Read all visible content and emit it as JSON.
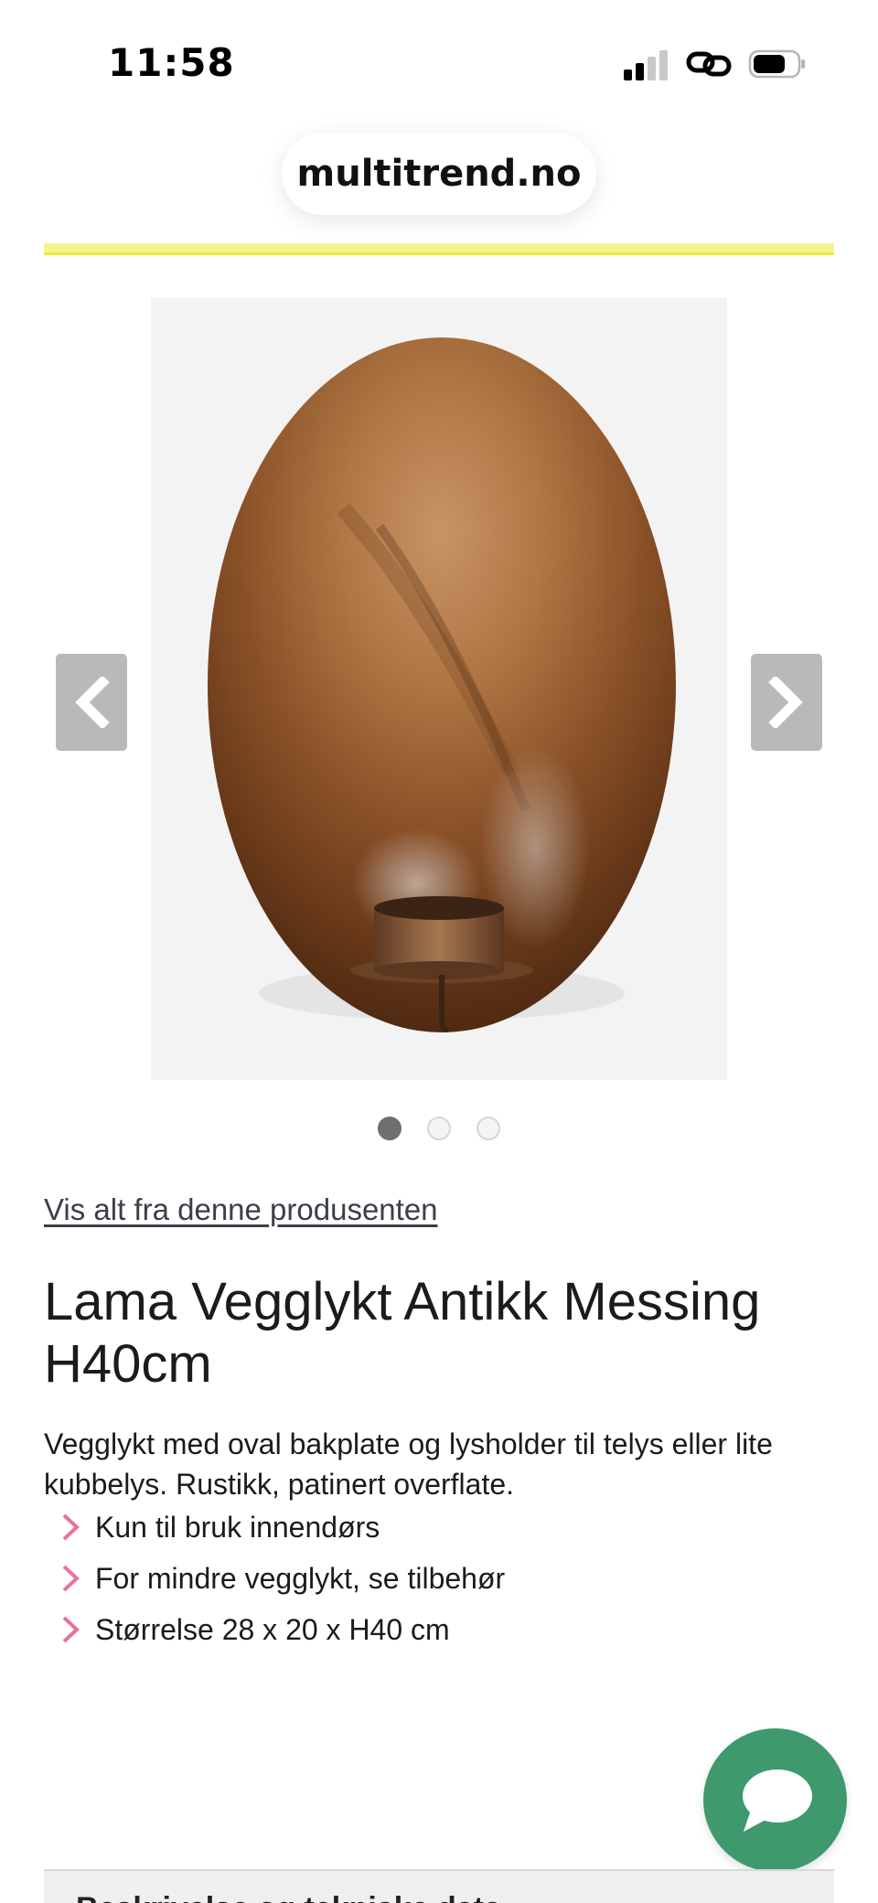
{
  "status_bar": {
    "time": "11:58",
    "icons": [
      "signal-icon",
      "link-icon",
      "battery-icon"
    ]
  },
  "browser": {
    "url": "multitrend.no"
  },
  "colors": {
    "accent_yellow": "#f4f38f",
    "chevron_pink": "#e8739a",
    "chat_green": "#3e9a6c",
    "nav_button_gray": "#b9b9b9"
  },
  "carousel": {
    "image_alt": "Lama Vegglykt Antikk Messing H40cm",
    "prev_icon": "chevron-left-icon",
    "next_icon": "chevron-right-icon",
    "total_slides": 3,
    "active_slide": 1
  },
  "product": {
    "vendor_link": "Vis alt fra denne produsenten",
    "title": "Lama Vegglykt Antikk Messing H40cm",
    "description": "Vegglykt med oval bakplate og lysholder til telys eller lite kubbelys. Rustikk, patinert overflate.",
    "features": [
      "Kun til bruk innendørs",
      "For mindre vegglykt, se tilbehør",
      "Størrelse 28 x 20 x H40 cm"
    ]
  },
  "chat": {
    "icon": "chat-bubble-icon"
  },
  "bottom_section": {
    "heading": "Beskrivelse og tekniske data"
  }
}
